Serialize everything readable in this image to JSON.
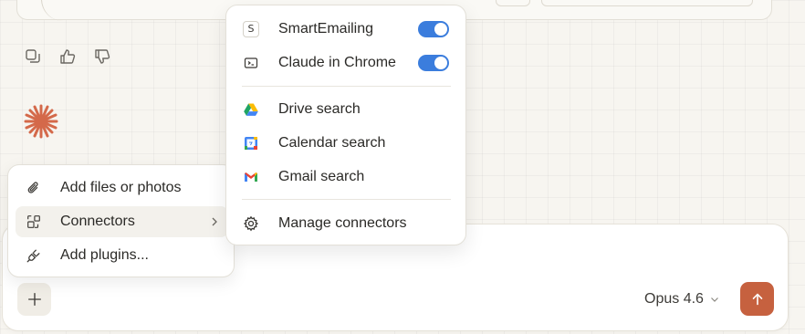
{
  "left_menu": {
    "items": [
      {
        "label": "Add files or photos",
        "icon": "paperclip-icon"
      },
      {
        "label": "Connectors",
        "icon": "connectors-icon"
      },
      {
        "label": "Add plugins...",
        "icon": "plug-icon"
      }
    ]
  },
  "connectors_menu": {
    "toggles": [
      {
        "label": "SmartEmailing",
        "icon_letter": "S",
        "enabled": true
      },
      {
        "label": "Claude in Chrome",
        "icon": "chrome-extension-icon",
        "enabled": true
      }
    ],
    "search_items": [
      {
        "label": "Drive search",
        "icon": "google-drive-icon"
      },
      {
        "label": "Calendar search",
        "icon": "google-calendar-icon"
      },
      {
        "label": "Gmail search",
        "icon": "gmail-icon"
      }
    ],
    "manage_label": "Manage connectors"
  },
  "composer": {
    "model_label": "Opus 4.6"
  },
  "colors": {
    "accent": "#c6613f",
    "toggle_on": "#3b7ddd",
    "background": "#f7f5f0"
  }
}
